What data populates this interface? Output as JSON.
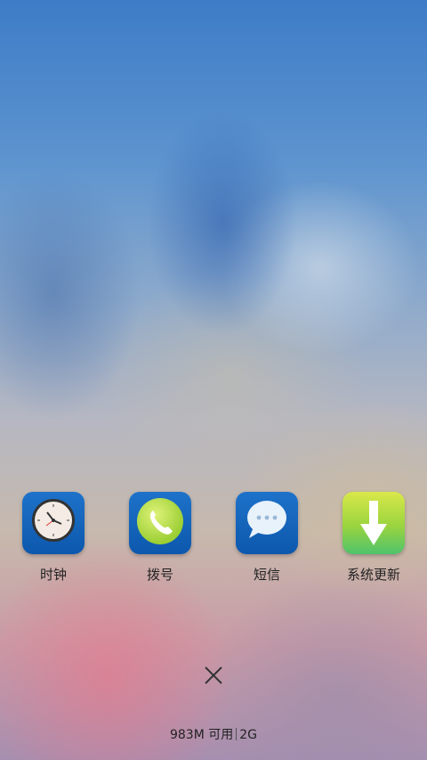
{
  "apps": [
    {
      "label": "时钟",
      "icon": "clock-icon"
    },
    {
      "label": "拨号",
      "icon": "phone-icon"
    },
    {
      "label": "短信",
      "icon": "message-icon"
    },
    {
      "label": "系统更新",
      "icon": "download-arrow-icon"
    }
  ],
  "close_button": {
    "icon": "close-icon"
  },
  "status": {
    "memory": "983M 可用",
    "network": "2G"
  },
  "colors": {
    "tile_blue": "#1465bd",
    "tile_green": "#9ad43f",
    "text": "#222222"
  }
}
